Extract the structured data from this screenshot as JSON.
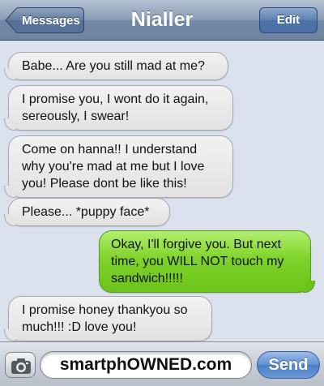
{
  "header": {
    "back_label": "Messages",
    "title": "Nialler",
    "edit_label": "Edit"
  },
  "messages": [
    {
      "direction": "incoming",
      "text": "Babe... Are you still mad at me?"
    },
    {
      "direction": "incoming",
      "text": "I promise you, I wont do it again, sereously, I swear!"
    },
    {
      "direction": "incoming",
      "text": "Come on hanna!! I understand why you're mad at me but I love you! Please dont be like this!"
    },
    {
      "direction": "incoming",
      "text": "Please... *puppy face*"
    },
    {
      "direction": "outgoing",
      "text": "Okay, I'll forgive you. But next time, you WILL NOT touch my sandwich!!!!!"
    },
    {
      "direction": "incoming",
      "text": "I promise honey thankyou so much!!! :D love you!"
    }
  ],
  "composer": {
    "field_text": "smartphOWNED.com",
    "send_label": "Send",
    "camera_icon": "camera-icon"
  },
  "colors": {
    "incoming_bubble": "#e6e6e6",
    "outgoing_bubble": "#7fd32a",
    "nav_bar": "#8a9db6",
    "background": "#dbe2ed"
  }
}
